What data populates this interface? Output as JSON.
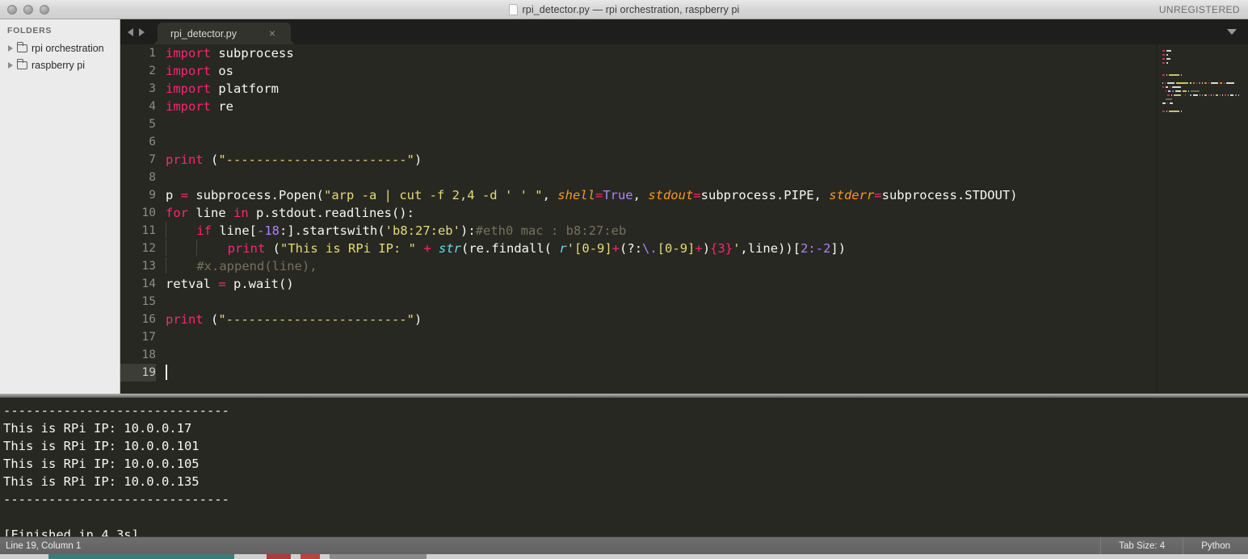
{
  "window": {
    "title": "rpi_detector.py — rpi orchestration, raspberry pi",
    "license_badge": "UNREGISTERED"
  },
  "sidebar": {
    "header": "FOLDERS",
    "folders": [
      {
        "label": "rpi orchestration"
      },
      {
        "label": "raspberry pi"
      }
    ]
  },
  "tabbar": {
    "tabs": [
      {
        "label": "rpi_detector.py",
        "close": "×"
      }
    ]
  },
  "editor": {
    "lines": [
      {
        "n": "1",
        "tokens": [
          {
            "t": "import",
            "c": "t-kw"
          },
          {
            "t": " subprocess",
            "c": "t-pln"
          }
        ]
      },
      {
        "n": "2",
        "tokens": [
          {
            "t": "import",
            "c": "t-kw"
          },
          {
            "t": " os",
            "c": "t-pln"
          }
        ]
      },
      {
        "n": "3",
        "tokens": [
          {
            "t": "import",
            "c": "t-kw"
          },
          {
            "t": " platform",
            "c": "t-pln"
          }
        ]
      },
      {
        "n": "4",
        "tokens": [
          {
            "t": "import",
            "c": "t-kw"
          },
          {
            "t": " re",
            "c": "t-pln"
          }
        ]
      },
      {
        "n": "5",
        "tokens": []
      },
      {
        "n": "6",
        "tokens": []
      },
      {
        "n": "7",
        "tokens": [
          {
            "t": "print",
            "c": "t-kw"
          },
          {
            "t": " (",
            "c": "t-pln"
          },
          {
            "t": "\"------------------------\"",
            "c": "t-str"
          },
          {
            "t": ")",
            "c": "t-pln"
          }
        ]
      },
      {
        "n": "8",
        "tokens": []
      },
      {
        "n": "9",
        "tokens": [
          {
            "t": "p ",
            "c": "t-pln"
          },
          {
            "t": "=",
            "c": "t-kw"
          },
          {
            "t": " subprocess.Popen(",
            "c": "t-pln"
          },
          {
            "t": "\"arp -a | cut -f 2,4 -d ' ' \"",
            "c": "t-str"
          },
          {
            "t": ", ",
            "c": "t-pln"
          },
          {
            "t": "shell",
            "c": "t-par"
          },
          {
            "t": "=",
            "c": "t-kw"
          },
          {
            "t": "True",
            "c": "t-num"
          },
          {
            "t": ", ",
            "c": "t-pln"
          },
          {
            "t": "stdout",
            "c": "t-par"
          },
          {
            "t": "=",
            "c": "t-kw"
          },
          {
            "t": "subprocess.PIPE, ",
            "c": "t-pln"
          },
          {
            "t": "stderr",
            "c": "t-par"
          },
          {
            "t": "=",
            "c": "t-kw"
          },
          {
            "t": "subprocess.STDOUT)",
            "c": "t-pln"
          }
        ]
      },
      {
        "n": "10",
        "tokens": [
          {
            "t": "for",
            "c": "t-kw"
          },
          {
            "t": " line ",
            "c": "t-pln"
          },
          {
            "t": "in",
            "c": "t-kw"
          },
          {
            "t": " p.stdout.readlines():",
            "c": "t-pln"
          }
        ]
      },
      {
        "n": "11",
        "indent": 1,
        "tokens": [
          {
            "t": "    ",
            "c": "t-pln"
          },
          {
            "t": "if",
            "c": "t-kw"
          },
          {
            "t": " line[",
            "c": "t-pln"
          },
          {
            "t": "-18",
            "c": "t-num"
          },
          {
            "t": ":].startswith(",
            "c": "t-pln"
          },
          {
            "t": "'b8:27:eb'",
            "c": "t-str"
          },
          {
            "t": "):",
            "c": "t-pln"
          },
          {
            "t": "#eth0 mac : b8:27:eb",
            "c": "t-cmt"
          }
        ]
      },
      {
        "n": "12",
        "indent": 2,
        "tokens": [
          {
            "t": "        ",
            "c": "t-pln"
          },
          {
            "t": "print",
            "c": "t-kw"
          },
          {
            "t": " (",
            "c": "t-pln"
          },
          {
            "t": "\"This is RPi IP: \"",
            "c": "t-str"
          },
          {
            "t": " ",
            "c": "t-pln"
          },
          {
            "t": "+",
            "c": "t-kw"
          },
          {
            "t": " ",
            "c": "t-pln"
          },
          {
            "t": "str",
            "c": "t-fn"
          },
          {
            "t": "(re.findall( ",
            "c": "t-pln"
          },
          {
            "t": "r",
            "c": "t-fn"
          },
          {
            "t": "'",
            "c": "t-str"
          },
          {
            "t": "[0-9]",
            "c": "t-str"
          },
          {
            "t": "+",
            "c": "t-kw"
          },
          {
            "t": "(?:",
            "c": "t-pln"
          },
          {
            "t": "\\.",
            "c": "t-num"
          },
          {
            "t": "[0-9]",
            "c": "t-str"
          },
          {
            "t": "+",
            "c": "t-kw"
          },
          {
            "t": ")",
            "c": "t-pln"
          },
          {
            "t": "{3}",
            "c": "t-kw"
          },
          {
            "t": "'",
            "c": "t-str"
          },
          {
            "t": ",line))[",
            "c": "t-pln"
          },
          {
            "t": "2:-2",
            "c": "t-num"
          },
          {
            "t": "])",
            "c": "t-pln"
          }
        ]
      },
      {
        "n": "13",
        "indent": 1,
        "tokens": [
          {
            "t": "    ",
            "c": "t-pln"
          },
          {
            "t": "#x.append(line),",
            "c": "t-cmt"
          }
        ]
      },
      {
        "n": "14",
        "tokens": [
          {
            "t": "retval ",
            "c": "t-pln"
          },
          {
            "t": "=",
            "c": "t-kw"
          },
          {
            "t": " p.wait()",
            "c": "t-pln"
          }
        ]
      },
      {
        "n": "15",
        "tokens": []
      },
      {
        "n": "16",
        "tokens": [
          {
            "t": "print",
            "c": "t-kw"
          },
          {
            "t": " (",
            "c": "t-pln"
          },
          {
            "t": "\"------------------------\"",
            "c": "t-str"
          },
          {
            "t": ")",
            "c": "t-pln"
          }
        ]
      },
      {
        "n": "17",
        "tokens": []
      },
      {
        "n": "18",
        "tokens": []
      },
      {
        "n": "19",
        "tokens": [],
        "active": true,
        "cursor": true
      }
    ]
  },
  "console": {
    "text": "------------------------------\nThis is RPi IP: 10.0.0.17\nThis is RPi IP: 10.0.0.101\nThis is RPi IP: 10.0.0.105\nThis is RPi IP: 10.0.0.135\n------------------------------\n\n[Finished in 4.3s]"
  },
  "statusbar": {
    "position": "Line 19, Column 1",
    "tab_size": "Tab Size: 4",
    "syntax": "Python"
  },
  "colors": {
    "editor_bg": "#272822",
    "keyword": "#f92672",
    "string": "#e6db74",
    "number": "#ae81ff",
    "function": "#66d9ef",
    "param": "#fd971f",
    "comment": "#75715e",
    "plain": "#f8f8f2",
    "sidebar_bg": "#ebebeb",
    "statusbar_bg": "#626262"
  }
}
